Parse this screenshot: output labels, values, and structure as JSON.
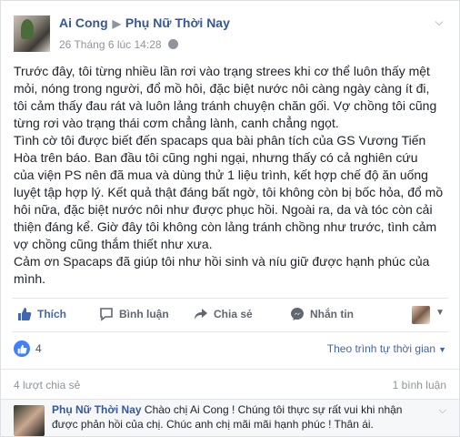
{
  "post": {
    "author": "Ai Cong",
    "target_page": "Phụ Nữ Thời Nay",
    "timestamp": "26 Tháng 6 lúc 14:28",
    "lines": [
      "Trước đây, tôi từng nhiều lần rơi vào trạng strees khi cơ thể luôn thấy mệt",
      "mỏi, nóng trong người, đổ mồ hôi, đặc biệt nước nôi càng ngày càng ít đi,",
      "tôi cảm thấy đau rát và luôn lảng tránh chuyện chăn gối. Vợ chồng tôi cũng",
      "từng rơi vào trạng thái cơm chẳng lành, canh chẳng ngọt.",
      "Tình cờ tôi được biết đến spacaps qua bài phân tích của GS Vương Tiến",
      "Hòa trên báo. Ban đầu tôi cũng nghi ngại, nhưng thấy có cả nghiên cứu",
      "của viện PS nên đã mua và dùng thử 1 liệu trình, kết hợp chế độ ăn uống",
      "luyệt tập hợp lý. Kết quả thật đáng bất ngờ, tôi không còn bị bốc hỏa, đổ mồ",
      "hôi nữa, đặc biệt nước nôi như được phục hồi. Ngoài ra, da và tóc còn cải",
      "thiện đáng kể. Giờ đây tôi không còn lảng tránh chồng như trước, tình cảm",
      "vợ chồng cũng thắm thiết như xưa.",
      "Cảm ơn Spacaps đã giúp tôi như hồi sinh và níu giữ được hạnh phúc của",
      "mình."
    ]
  },
  "actions": {
    "like": "Thích",
    "comment": "Bình luận",
    "share": "Chia sẻ",
    "message": "Nhắn tin"
  },
  "reactions": {
    "like_count": "4",
    "sort_label": "Theo trình tự thời gian"
  },
  "stats": {
    "shares": "4 lượt chia sẻ",
    "comments": "1 bình luận"
  },
  "comment": {
    "author": "Phụ Nữ Thời Nay",
    "text": "Chào chị Ai Cong ! Chúng tôi thực sự rất vui khi nhận được phản hồi của chị. Chúc anh chị mãi mãi hạnh phúc ! Thân ái."
  },
  "colors": {
    "link": "#365899",
    "accent": "#4267b2",
    "like_badge": "#4080ff"
  }
}
